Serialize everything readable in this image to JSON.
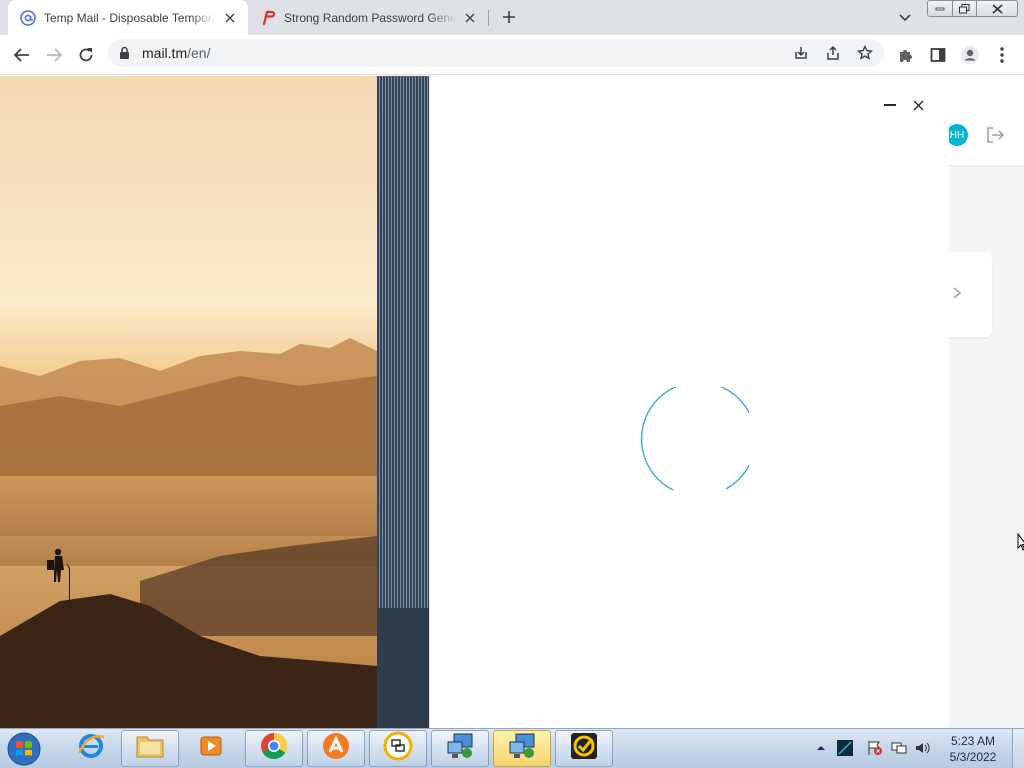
{
  "browser": {
    "tabs": [
      {
        "title": "Temp Mail - Disposable Temporary Email",
        "active": true,
        "favicon": "at-sign-icon"
      },
      {
        "title": "Strong Random Password Generator",
        "active": false,
        "favicon": "password-generator-icon"
      }
    ],
    "url_host": "mail.tm",
    "url_path": "/en/"
  },
  "page": {
    "avatar_initials": "HH",
    "colors": {
      "accent": "#06b6d4",
      "spinner": "#3fa9d6"
    }
  },
  "taskbar": {
    "apps": [
      "internet-explorer",
      "windows-explorer",
      "media-player",
      "chrome",
      "avast",
      "network-tool",
      "remote-desktop-1",
      "remote-desktop-2",
      "norton"
    ],
    "time": "5:23 AM",
    "date": "5/3/2022"
  }
}
